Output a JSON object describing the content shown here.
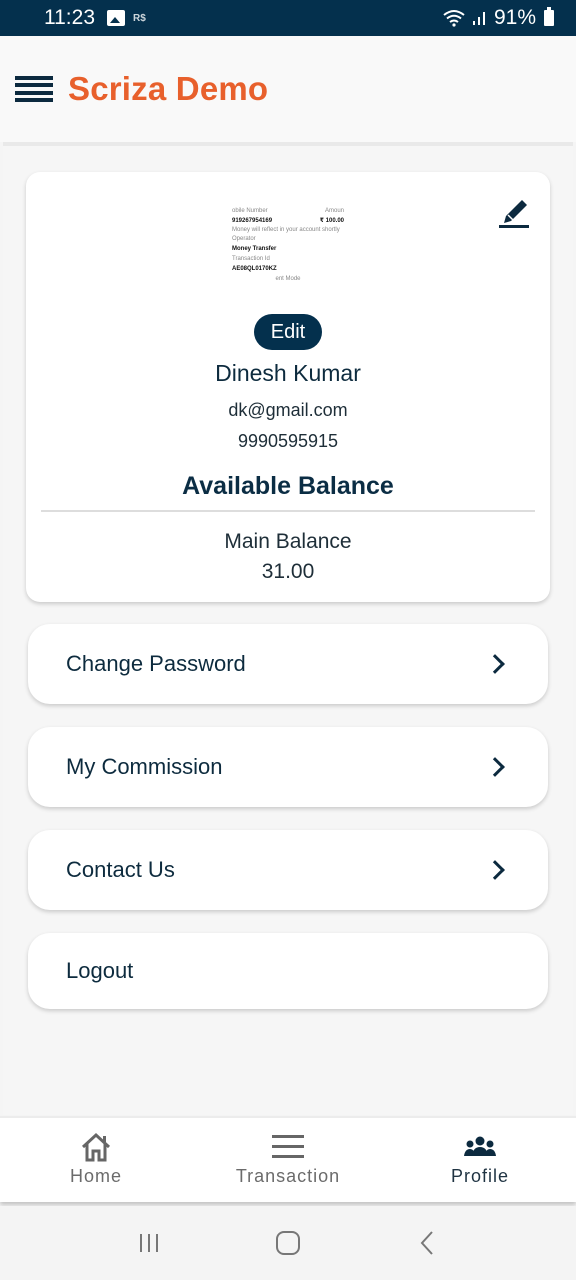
{
  "status_bar": {
    "time": "11:23",
    "notification_icons": [
      "image-icon",
      "rs-app-icon"
    ],
    "battery": "91%",
    "signal_icons": [
      "wifi-icon",
      "signal-icon",
      "battery-icon"
    ]
  },
  "app_bar": {
    "title": "Scriza Demo",
    "menu_icon": "hamburger-icon",
    "title_color": "#e8602c"
  },
  "profile": {
    "avatar_preview": {
      "mobile_label": "obile Number",
      "amount_label": "Amoun",
      "mobile_value": "919267954169",
      "amount_value": "₹ 100.00",
      "note": "Money will reflect in your account shortly",
      "operator_label": "Operator",
      "operator_value": "Money Transfer",
      "txn_label": "Transaction Id",
      "txn_value": "AE08QL0170KZ",
      "mode_label": "ent Mode"
    },
    "edit_label": "Edit",
    "name": "Dinesh Kumar",
    "email": "dk@gmail.com",
    "phone": "9990595915",
    "available_balance_label": "Available Balance",
    "main_balance_label": "Main Balance",
    "main_balance_value": "31.00"
  },
  "menu": [
    {
      "label": "Change Password",
      "has_chevron": true
    },
    {
      "label": "My Commission",
      "has_chevron": true
    },
    {
      "label": "Contact Us",
      "has_chevron": true
    },
    {
      "label": "Logout",
      "has_chevron": false
    }
  ],
  "bottom_nav": [
    {
      "label": "Home",
      "icon": "home-icon",
      "active": false
    },
    {
      "label": "Transaction",
      "icon": "list-icon",
      "active": false
    },
    {
      "label": "Profile",
      "icon": "people-icon",
      "active": true
    }
  ],
  "colors": {
    "primary_dark": "#04304d",
    "accent": "#e8602c",
    "text": "#0d2b3e"
  }
}
